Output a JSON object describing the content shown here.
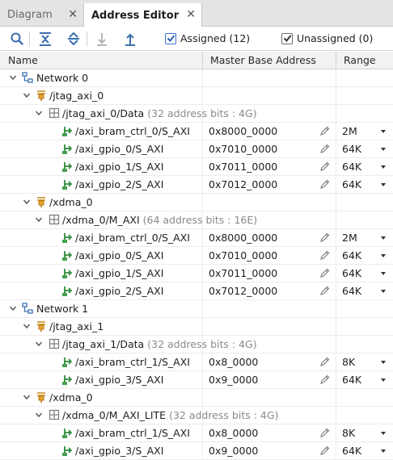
{
  "tabs": [
    {
      "label": "Diagram"
    },
    {
      "label": "Address Editor"
    }
  ],
  "toolbar": {
    "assigned_label": "Assigned (12)",
    "unassigned_label": "Unassigned (0)"
  },
  "columns": {
    "name": "Name",
    "address": "Master Base Address",
    "range": "Range"
  },
  "rows": [
    {
      "depth": 0,
      "kind": "network",
      "label": "Network 0"
    },
    {
      "depth": 1,
      "kind": "master",
      "label": "/jtag_axi_0"
    },
    {
      "depth": 2,
      "kind": "space",
      "label": "/jtag_axi_0/Data",
      "note": "(32 address bits : 4G)"
    },
    {
      "depth": 3,
      "kind": "slave",
      "label": "/axi_bram_ctrl_0/S_AXI",
      "address": "0x8000_0000",
      "range": "2M"
    },
    {
      "depth": 3,
      "kind": "slave",
      "label": "/axi_gpio_0/S_AXI",
      "address": "0x7010_0000",
      "range": "64K"
    },
    {
      "depth": 3,
      "kind": "slave",
      "label": "/axi_gpio_1/S_AXI",
      "address": "0x7011_0000",
      "range": "64K"
    },
    {
      "depth": 3,
      "kind": "slave",
      "label": "/axi_gpio_2/S_AXI",
      "address": "0x7012_0000",
      "range": "64K"
    },
    {
      "depth": 1,
      "kind": "master",
      "label": "/xdma_0"
    },
    {
      "depth": 2,
      "kind": "space",
      "label": "/xdma_0/M_AXI",
      "note": "(64 address bits : 16E)"
    },
    {
      "depth": 3,
      "kind": "slave",
      "label": "/axi_bram_ctrl_0/S_AXI",
      "address": "0x8000_0000",
      "range": "2M"
    },
    {
      "depth": 3,
      "kind": "slave",
      "label": "/axi_gpio_0/S_AXI",
      "address": "0x7010_0000",
      "range": "64K"
    },
    {
      "depth": 3,
      "kind": "slave",
      "label": "/axi_gpio_1/S_AXI",
      "address": "0x7011_0000",
      "range": "64K"
    },
    {
      "depth": 3,
      "kind": "slave",
      "label": "/axi_gpio_2/S_AXI",
      "address": "0x7012_0000",
      "range": "64K"
    },
    {
      "depth": 0,
      "kind": "network",
      "label": "Network 1"
    },
    {
      "depth": 1,
      "kind": "master",
      "label": "/jtag_axi_1"
    },
    {
      "depth": 2,
      "kind": "space",
      "label": "/jtag_axi_1/Data",
      "note": "(32 address bits : 4G)"
    },
    {
      "depth": 3,
      "kind": "slave",
      "label": "/axi_bram_ctrl_1/S_AXI",
      "address": "0x8_0000",
      "range": "8K"
    },
    {
      "depth": 3,
      "kind": "slave",
      "label": "/axi_gpio_3/S_AXI",
      "address": "0x9_0000",
      "range": "64K"
    },
    {
      "depth": 1,
      "kind": "master",
      "label": "/xdma_0"
    },
    {
      "depth": 2,
      "kind": "space",
      "label": "/xdma_0/M_AXI_LITE",
      "note": "(32 address bits : 4G)"
    },
    {
      "depth": 3,
      "kind": "slave",
      "label": "/axi_bram_ctrl_1/S_AXI",
      "address": "0x8_0000",
      "range": "8K"
    },
    {
      "depth": 3,
      "kind": "slave",
      "label": "/axi_gpio_3/S_AXI",
      "address": "0x9_0000",
      "range": "64K"
    }
  ]
}
